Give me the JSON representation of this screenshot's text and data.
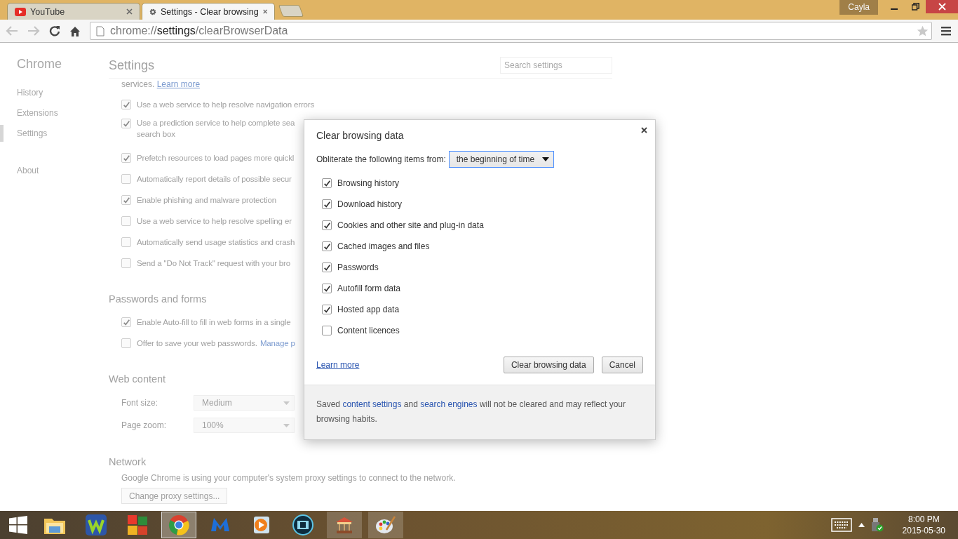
{
  "browser": {
    "tabs": [
      {
        "title": "YouTube",
        "selected": false,
        "kind": "youtube"
      },
      {
        "title": "Settings - Clear browsing",
        "selected": true,
        "kind": "settings"
      }
    ],
    "profile": "Cayla",
    "address": {
      "scheme": "chrome://",
      "host": "settings",
      "path": "/clearBrowserData"
    }
  },
  "settings_page": {
    "sidebar": {
      "title": "Chrome",
      "items": [
        {
          "label": "History",
          "selected": false
        },
        {
          "label": "Extensions",
          "selected": false
        },
        {
          "label": "Settings",
          "selected": true
        },
        {
          "label": "About",
          "selected": false
        }
      ]
    },
    "title": "Settings",
    "search": {
      "placeholder": "Search settings"
    },
    "intro": {
      "text": "services.",
      "link": "Learn more"
    },
    "privacy_options": [
      {
        "lines": [
          "Use a web service to help resolve navigation errors"
        ],
        "checked": true
      },
      {
        "lines": [
          "Use a prediction service to help complete sea",
          "search box"
        ],
        "checked": true
      },
      {
        "lines": [
          "Prefetch resources to load pages more quickl"
        ],
        "checked": true
      },
      {
        "lines": [
          "Automatically report details of possible secur"
        ],
        "checked": false
      },
      {
        "lines": [
          "Enable phishing and malware protection"
        ],
        "checked": true
      },
      {
        "lines": [
          "Use a web service to help resolve spelling er"
        ],
        "checked": false
      },
      {
        "lines": [
          "Automatically send usage statistics and crash"
        ],
        "checked": false
      },
      {
        "lines": [
          "Send a \"Do Not Track\" request with your bro"
        ],
        "checked": false
      }
    ],
    "passwords_and_forms": {
      "heading": "Passwords and forms",
      "options": [
        {
          "lines": [
            "Enable Auto-fill to fill in web forms in a single"
          ],
          "checked": true
        },
        {
          "lines": [
            "Offer to save your web passwords."
          ],
          "link": "Manage p",
          "checked": false
        }
      ]
    },
    "web_content": {
      "heading": "Web content",
      "fields": [
        {
          "label": "Font size:",
          "value": "Medium"
        },
        {
          "label": "Page zoom:",
          "value": "100%"
        }
      ]
    },
    "network": {
      "heading": "Network",
      "text": "Google Chrome is using your computer's system proxy settings to connect to the network.",
      "button": "Change proxy settings..."
    }
  },
  "dialog": {
    "title": "Clear browsing data",
    "range_label": "Obliterate the following items from:",
    "range_value": "the beginning of time",
    "items": [
      {
        "label": "Browsing history",
        "checked": true
      },
      {
        "label": "Download history",
        "checked": true
      },
      {
        "label": "Cookies and other site and plug-in data",
        "checked": true
      },
      {
        "label": "Cached images and files",
        "checked": true
      },
      {
        "label": "Passwords",
        "checked": true
      },
      {
        "label": "Autofill form data",
        "checked": true
      },
      {
        "label": "Hosted app data",
        "checked": true
      },
      {
        "label": "Content licences",
        "checked": false
      }
    ],
    "learn_more": "Learn more",
    "buttons": [
      {
        "label": "Clear browsing data",
        "kind": "primary"
      },
      {
        "label": "Cancel",
        "kind": "normal"
      }
    ],
    "footer": [
      {
        "kind": "text",
        "text": "Saved"
      },
      {
        "kind": "link",
        "text": "content settings"
      },
      {
        "kind": "text",
        "text": "and"
      },
      {
        "kind": "link",
        "text": "search engines"
      },
      {
        "kind": "text",
        "text": "will not be cleared and may reflect your browsing habits."
      }
    ]
  },
  "taskbar": {
    "apps": [
      {
        "kind": "folder",
        "running": false,
        "selected": false
      },
      {
        "kind": "w-app",
        "running": false,
        "selected": false
      },
      {
        "kind": "squares",
        "running": false,
        "selected": false
      },
      {
        "kind": "browser",
        "running": true,
        "selected": true
      },
      {
        "kind": "m-logo",
        "running": false,
        "selected": false
      },
      {
        "kind": "player",
        "running": false,
        "selected": false
      },
      {
        "kind": "film",
        "running": false,
        "selected": false
      },
      {
        "kind": "carousel",
        "running": true,
        "selected": false
      },
      {
        "kind": "paint",
        "running": true,
        "selected": false
      }
    ],
    "time": "8:00 PM",
    "date": "2015-05-30"
  }
}
